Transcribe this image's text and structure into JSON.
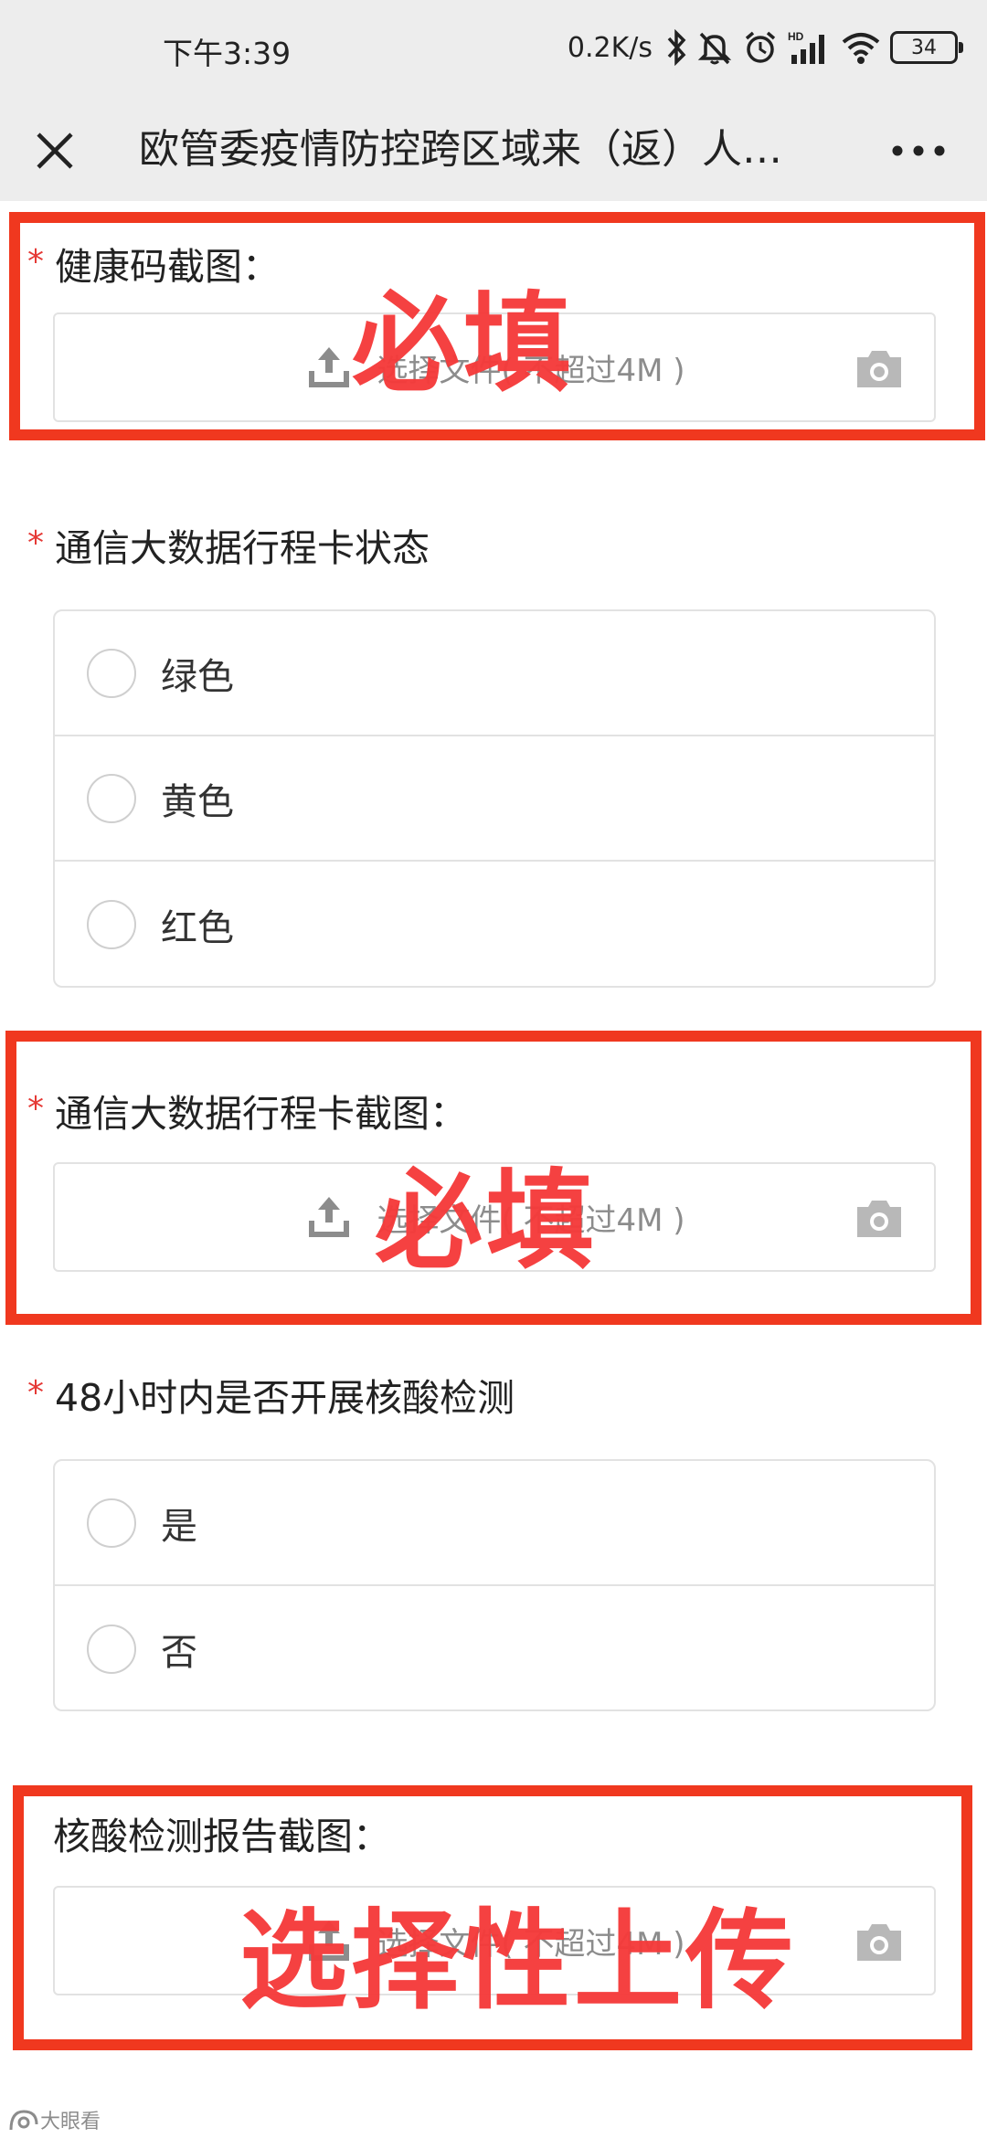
{
  "status_bar": {
    "time": "下午3:39",
    "network_speed": "0.2K/s",
    "battery": "34",
    "icons": [
      "bluetooth-icon",
      "mute-bell-icon",
      "alarm-icon",
      "hd-signal-icon",
      "wifi-icon",
      "battery-icon"
    ]
  },
  "nav": {
    "title": "欧管委疫情防控跨区域来（返）人…",
    "close_icon": "close-icon",
    "more_icon": "more-dots-icon"
  },
  "form": {
    "required_mark": "*",
    "health_code": {
      "title": "健康码截图：",
      "upload_text": "选择文件( 不超过4M )"
    },
    "itinerary_status": {
      "title": "通信大数据行程卡状态",
      "options": [
        "绿色",
        "黄色",
        "红色"
      ]
    },
    "itinerary_screenshot": {
      "title": "通信大数据行程卡截图：",
      "upload_text": "选择文件( 不超过4M )"
    },
    "nucleic_test": {
      "title": "48小时内是否开展核酸检测",
      "options": [
        "是",
        "否"
      ]
    },
    "nucleic_report": {
      "title": "核酸检测报告截图：",
      "upload_text": "选择文件( 不超过4M )"
    }
  },
  "annotations": {
    "required_1": "必填",
    "required_2": "必填",
    "optional": "选择性上传",
    "color": "#f0381f"
  },
  "watermark": "大眼看"
}
